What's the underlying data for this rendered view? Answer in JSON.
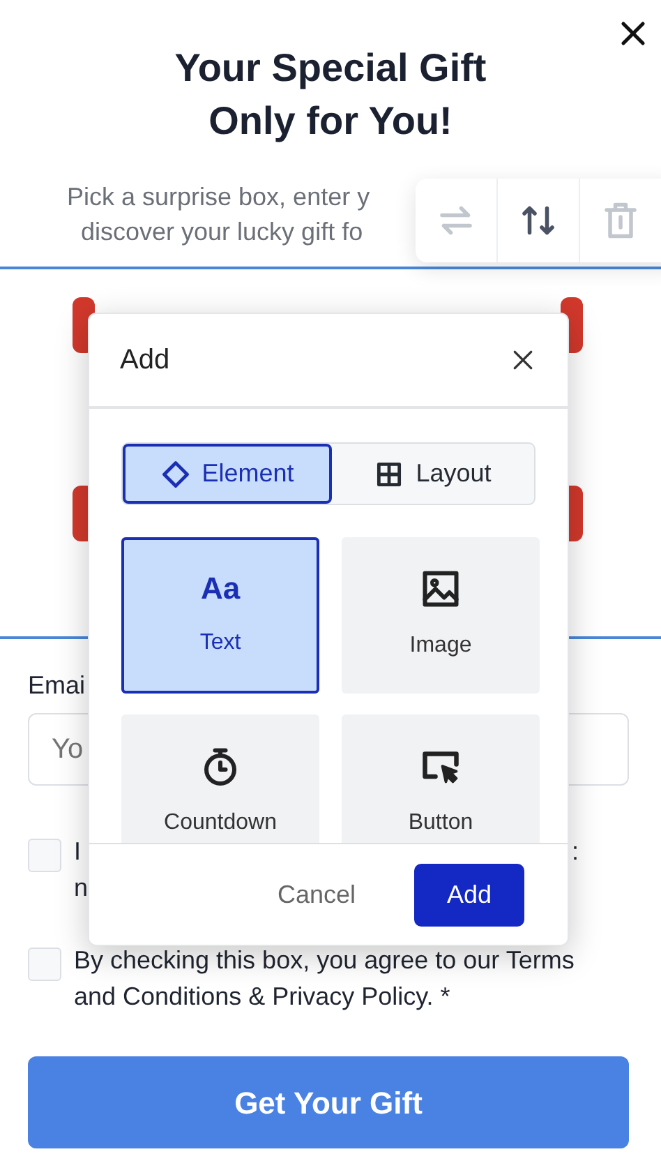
{
  "title_lines": [
    "Your Special Gift",
    "Only for You!"
  ],
  "subtitle_lines": [
    "Pick a surprise box, enter y",
    "discover your lucky gift fo"
  ],
  "toolbar": [
    {
      "kind": "swap",
      "disabled": true
    },
    {
      "kind": "reorder",
      "disabled": false
    },
    {
      "kind": "delete",
      "disabled": true
    }
  ],
  "form": {
    "email_label": "Emai",
    "email_placeholder": "Yo",
    "consents": [
      {
        "checked": false,
        "line_1_start": "I",
        "line_1_end": ":",
        "line_2": "n"
      },
      {
        "checked": false,
        "text": "By checking this box, you agree to our Terms and Conditions & Privacy Policy. *"
      }
    ],
    "submit": "Get Your Gift"
  },
  "dialog": {
    "title": "Add",
    "tabs": [
      {
        "label": "Element",
        "kind": "element",
        "selected": true
      },
      {
        "label": "Layout",
        "kind": "layout",
        "selected": false
      }
    ],
    "tiles": [
      {
        "label": "Text",
        "kind": "text",
        "glyph": "Aa",
        "selected": true
      },
      {
        "label": "Image",
        "kind": "image",
        "selected": false
      },
      {
        "label": "Countdown",
        "kind": "countdown",
        "selected": false
      },
      {
        "label": "Button",
        "kind": "button",
        "selected": false
      }
    ],
    "cancel": "Cancel",
    "confirm": "Add"
  }
}
